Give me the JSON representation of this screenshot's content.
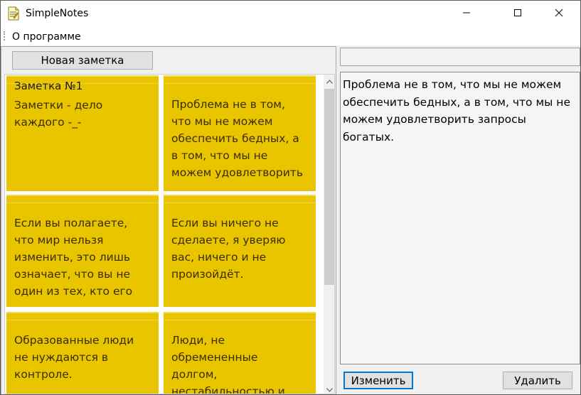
{
  "window": {
    "title": "SimpleNotes",
    "app_icon": "notepad-icon",
    "controls": [
      "minimize-icon",
      "maximize-icon",
      "close-icon"
    ]
  },
  "menu": {
    "items": [
      {
        "label": "О программе"
      }
    ]
  },
  "left_pane": {
    "new_note_label": "Новая заметка",
    "notes": [
      {
        "title": "Заметка №1",
        "text": "Заметки - дело\nкаждого -_-"
      },
      {
        "title": "",
        "text": "Проблема не в том,\nчто мы не можем\nобеспечить бедных, а\nв том, что мы не\nможем удовлетворить"
      },
      {
        "title": "",
        "text": "Если вы полагаете,\nчто мир нельзя\nизменить, это лишь\nозначает, что вы не\nодин из тех, кто его"
      },
      {
        "title": "",
        "text": "Если вы ничего не\nсделаете, я уверяю\nвас, ничего и не\nпроизойдёт."
      },
      {
        "title": "",
        "text": "Образованные люди\nне нуждаются в\nконтроле."
      },
      {
        "title": "",
        "text": "Люди, не\nобремененные\nдолгом,\nнестабильностью и"
      }
    ],
    "note_color": "#e9c500"
  },
  "right_pane": {
    "title_value": "",
    "content_text": "Проблема не в том, что мы не можем обеспечить бедных, а в том, что мы не можем удовлетворить запросы богатых.",
    "edit_label": "Изменить",
    "delete_label": "Удалить"
  }
}
